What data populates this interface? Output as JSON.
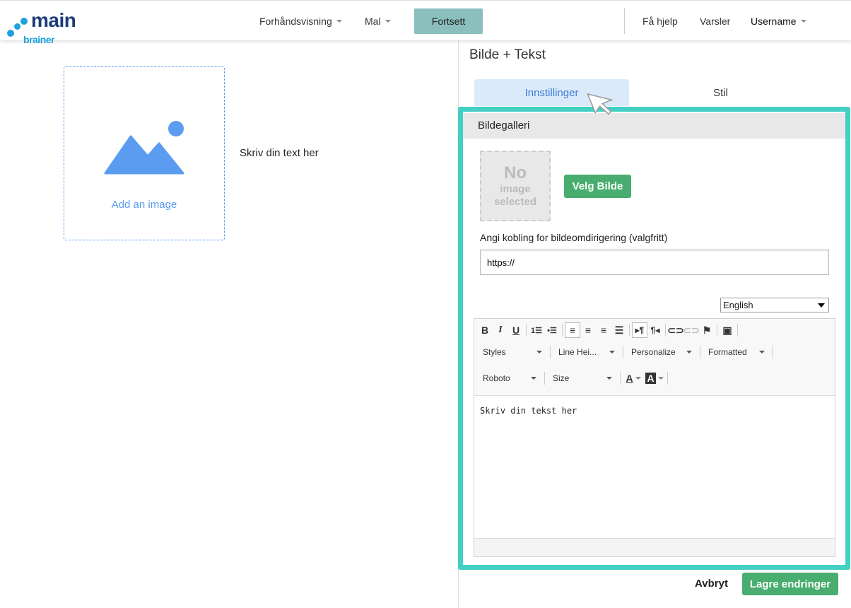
{
  "header": {
    "logo_a": "main",
    "logo_b": "brainer",
    "nav": {
      "preview": "Forhåndsvisning",
      "template": "Mal",
      "continue": "Fortsett",
      "help": "Få hjelp",
      "alerts": "Varsler",
      "user": "Username"
    }
  },
  "canvas": {
    "add_image": "Add an image",
    "text": "Skriv din text her"
  },
  "panel": {
    "title": "Bilde + Tekst",
    "tabs": [
      "Innstillinger",
      "Stil"
    ],
    "gallery": {
      "heading": "Bildegalleri",
      "no_image": [
        "No",
        "image",
        "selected"
      ],
      "choose": "Velg Bilde",
      "link_label": "Angi kobling for bildeomdirigering (valgfritt)",
      "link_value": "https://"
    },
    "language": "English",
    "toolbar": {
      "styles": "Styles",
      "line_height": "Line Hei...",
      "personalize": "Personalize",
      "formatted": "Formatted",
      "font": "Roboto",
      "size": "Size"
    },
    "editor_text": "Skriv din tekst her"
  },
  "footer": {
    "cancel": "Avbryt",
    "save": "Lagre endringer"
  },
  "colors": {
    "accent_teal": "#43cfc4",
    "green": "#48ad6e",
    "blue": "#5b9cf0",
    "continue_bg": "#8abfbd"
  }
}
